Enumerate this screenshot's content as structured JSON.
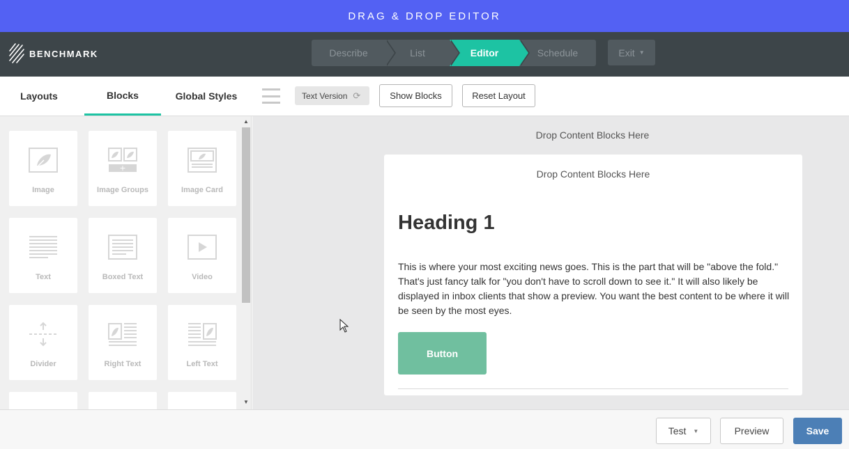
{
  "app": {
    "title": "DRAG & DROP EDITOR",
    "brand": "BENCHMARK"
  },
  "steps": [
    {
      "label": "Describe"
    },
    {
      "label": "List"
    },
    {
      "label": "Editor",
      "active": true
    },
    {
      "label": "Schedule"
    }
  ],
  "exit_label": "Exit",
  "tabs": [
    {
      "label": "Layouts"
    },
    {
      "label": "Blocks",
      "active": true
    },
    {
      "label": "Global Styles"
    }
  ],
  "toolbar": {
    "text_version": "Text Version",
    "show_blocks": "Show Blocks",
    "reset_layout": "Reset Layout"
  },
  "blocks": [
    {
      "label": "Image",
      "icon": "image-icon"
    },
    {
      "label": "Image Groups",
      "icon": "image-groups-icon"
    },
    {
      "label": "Image Card",
      "icon": "image-card-icon"
    },
    {
      "label": "Text",
      "icon": "text-icon"
    },
    {
      "label": "Boxed Text",
      "icon": "boxed-text-icon"
    },
    {
      "label": "Video",
      "icon": "video-icon"
    },
    {
      "label": "Divider",
      "icon": "divider-icon"
    },
    {
      "label": "Right Text",
      "icon": "right-text-icon"
    },
    {
      "label": "Left Text",
      "icon": "left-text-icon"
    }
  ],
  "canvas": {
    "drop_outer": "Drop Content Blocks Here",
    "drop_inner": "Drop Content Blocks Here",
    "heading": "Heading 1",
    "paragraph": "This is where your most exciting news goes. This is the part that will be \"above the fold.\" That's just fancy talk for \"you don't have to scroll down to see it.\" It will also likely be displayed in inbox clients that show a preview. You want the best content to be where it will be seen by the most eyes.",
    "button_label": "Button"
  },
  "footer": {
    "test": "Test",
    "preview": "Preview",
    "save": "Save"
  },
  "colors": {
    "header": "#5361f3",
    "nav": "#3d4549",
    "accent": "#1dc3a3",
    "cta": "#70bf9f",
    "save": "#4c7fb6"
  }
}
